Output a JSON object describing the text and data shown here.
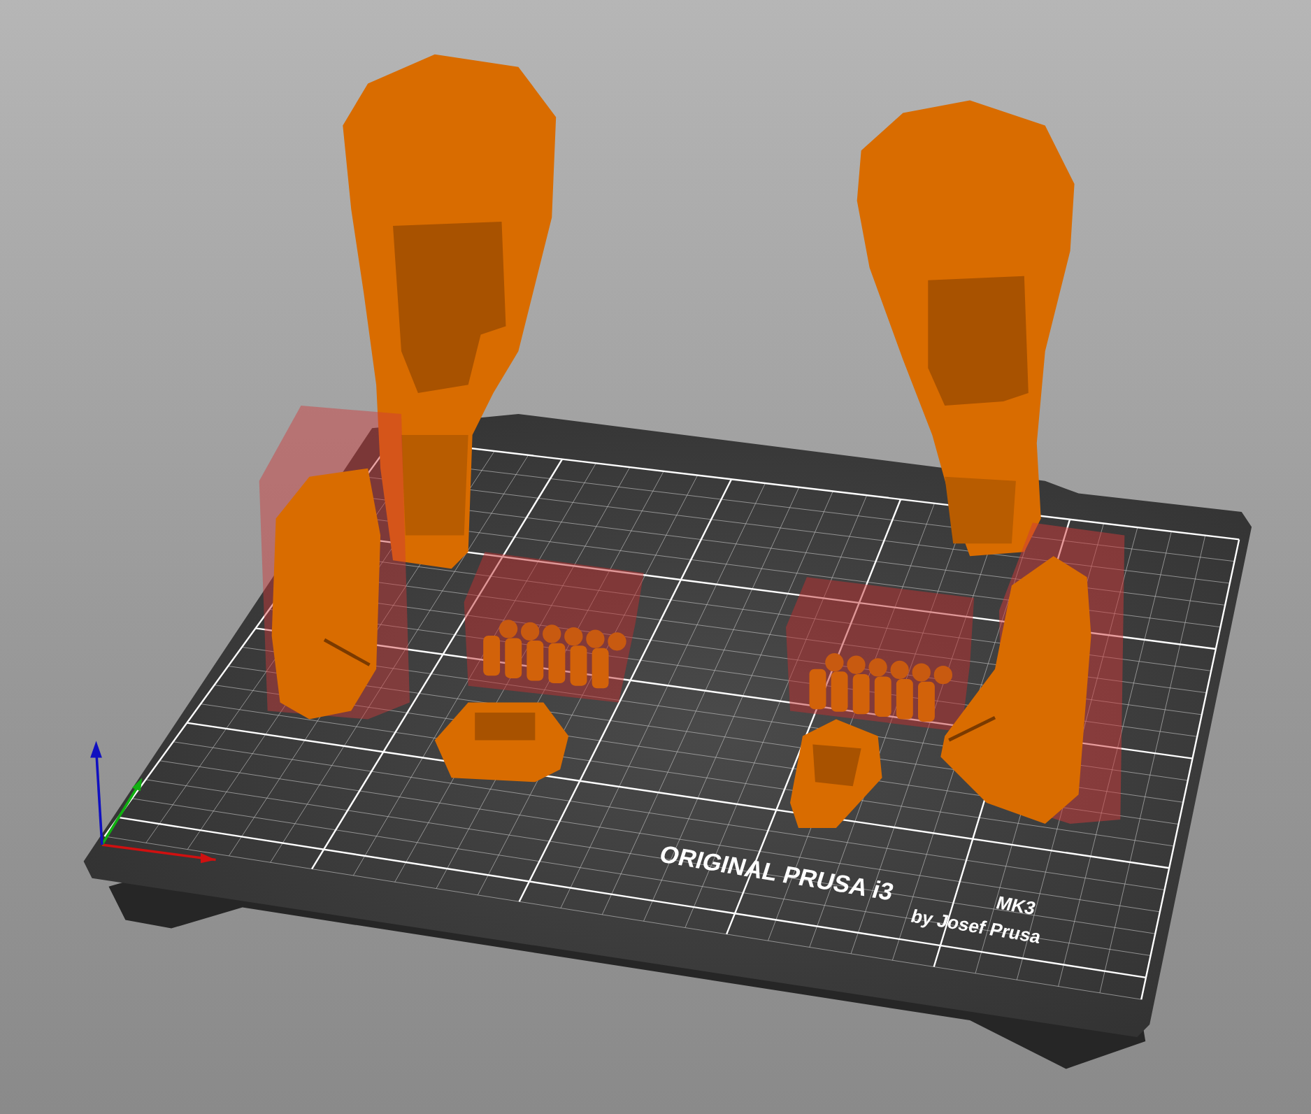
{
  "viewport": {
    "bed_label": "ORIGINAL PRUSA i3",
    "bed_model": "MK3",
    "bed_byline": "by Josef Prusa"
  }
}
